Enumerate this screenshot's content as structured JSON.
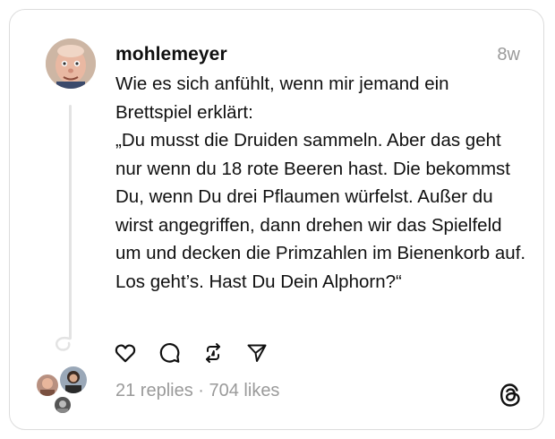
{
  "post": {
    "username": "mohlemeyer",
    "timestamp": "8w",
    "text": "Wie es sich anfühlt, wenn mir jemand ein Brettspiel erklärt:\n„Du musst die Druiden sammeln. Aber das geht nur wenn du 18 rote Beeren hast. Die bekommst Du, wenn Du drei Pflaumen würfelst. Außer du wirst angegriffen, dann drehen wir das Spielfeld um und decken die Primzahlen im Bienenkorb auf. Los geht’s. Hast Du Dein Alphorn?“"
  },
  "actions": {
    "icons": [
      "heart-icon",
      "comment-icon",
      "repost-icon",
      "send-icon"
    ]
  },
  "stats": {
    "replies": "21 replies",
    "separator": " · ",
    "likes": "704 likes"
  },
  "colors": {
    "text": "#101010",
    "muted": "#9a9a9a",
    "border": "#dcdcdc",
    "thread_line": "#e3e3e3"
  }
}
